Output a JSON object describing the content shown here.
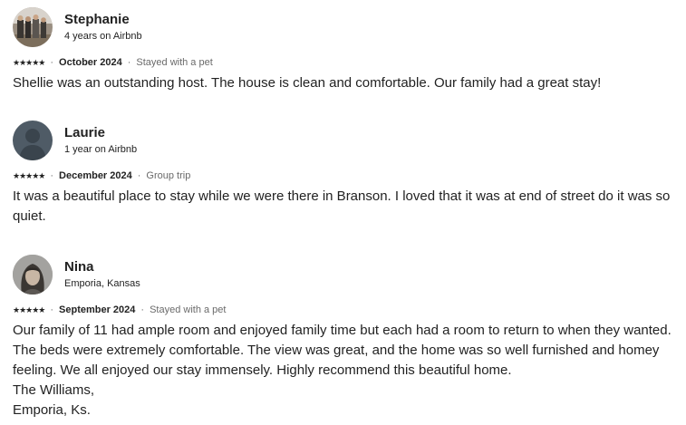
{
  "reviews": [
    {
      "name": "Stephanie",
      "subtitle": "4 years on Airbnb",
      "rating_stars": "★★★★★",
      "rating": 5,
      "date": "October 2024",
      "trip_type": "Stayed with a pet",
      "text": "Shellie was an outstanding host. The house is clean and comfortable. Our family had a great stay!",
      "separator": "·"
    },
    {
      "name": "Laurie",
      "subtitle": "1 year on Airbnb",
      "rating_stars": "★★★★★",
      "rating": 5,
      "date": "December 2024",
      "trip_type": "Group trip",
      "text": "It was a beautiful place to stay while we were there in Branson. I loved that it was at end of street do it was so quiet.",
      "separator": "·"
    },
    {
      "name": "Nina",
      "subtitle": "Emporia, Kansas",
      "rating_stars": "★★★★★",
      "rating": 5,
      "date": "September 2024",
      "trip_type": "Stayed with a pet",
      "text": "Our family of 11 had ample room and enjoyed family time but each had a room to return to when they wanted.   The beds were extremely comfortable.  The view was great, and the home was so well furnished and homey feeling. We all enjoyed our stay immensely.  Highly recommend this beautiful home.\nThe Williams,\nEmporia, Ks.",
      "separator": "·"
    }
  ],
  "colors": {
    "text": "#222222",
    "muted": "#6a6a6a",
    "default_avatar_bg": "#4f5b66"
  }
}
